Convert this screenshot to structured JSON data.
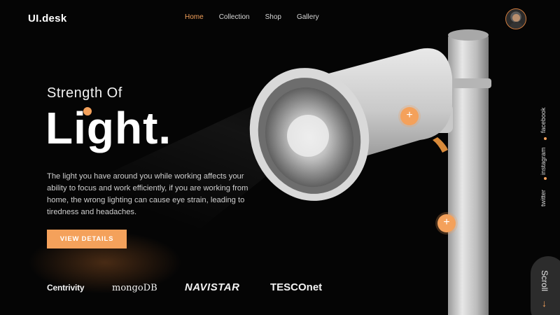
{
  "header": {
    "logo": "UI.desk",
    "nav": [
      "Home",
      "Collection",
      "Shop",
      "Gallery"
    ],
    "active_nav": "Home"
  },
  "hero": {
    "subtitle": "Strength Of",
    "title": "Light.",
    "description": "The light you have around you while working affects your ability to focus and work efficiently, if you are working from home, the wrong lighting can cause eye strain, leading to tiredness and headaches.",
    "cta": "VIEW DETAILS"
  },
  "brands": [
    "Centrivity",
    "mongoDB",
    "NAVISTAR",
    "TESCOnet"
  ],
  "hotspots": [
    "+",
    "+"
  ],
  "social": [
    "facebook",
    "instagram",
    "twitter"
  ],
  "scroll": {
    "label": "Scroll",
    "icon": "arrow-down-icon"
  },
  "colors": {
    "accent": "#f4a15b",
    "background": "#050505"
  }
}
